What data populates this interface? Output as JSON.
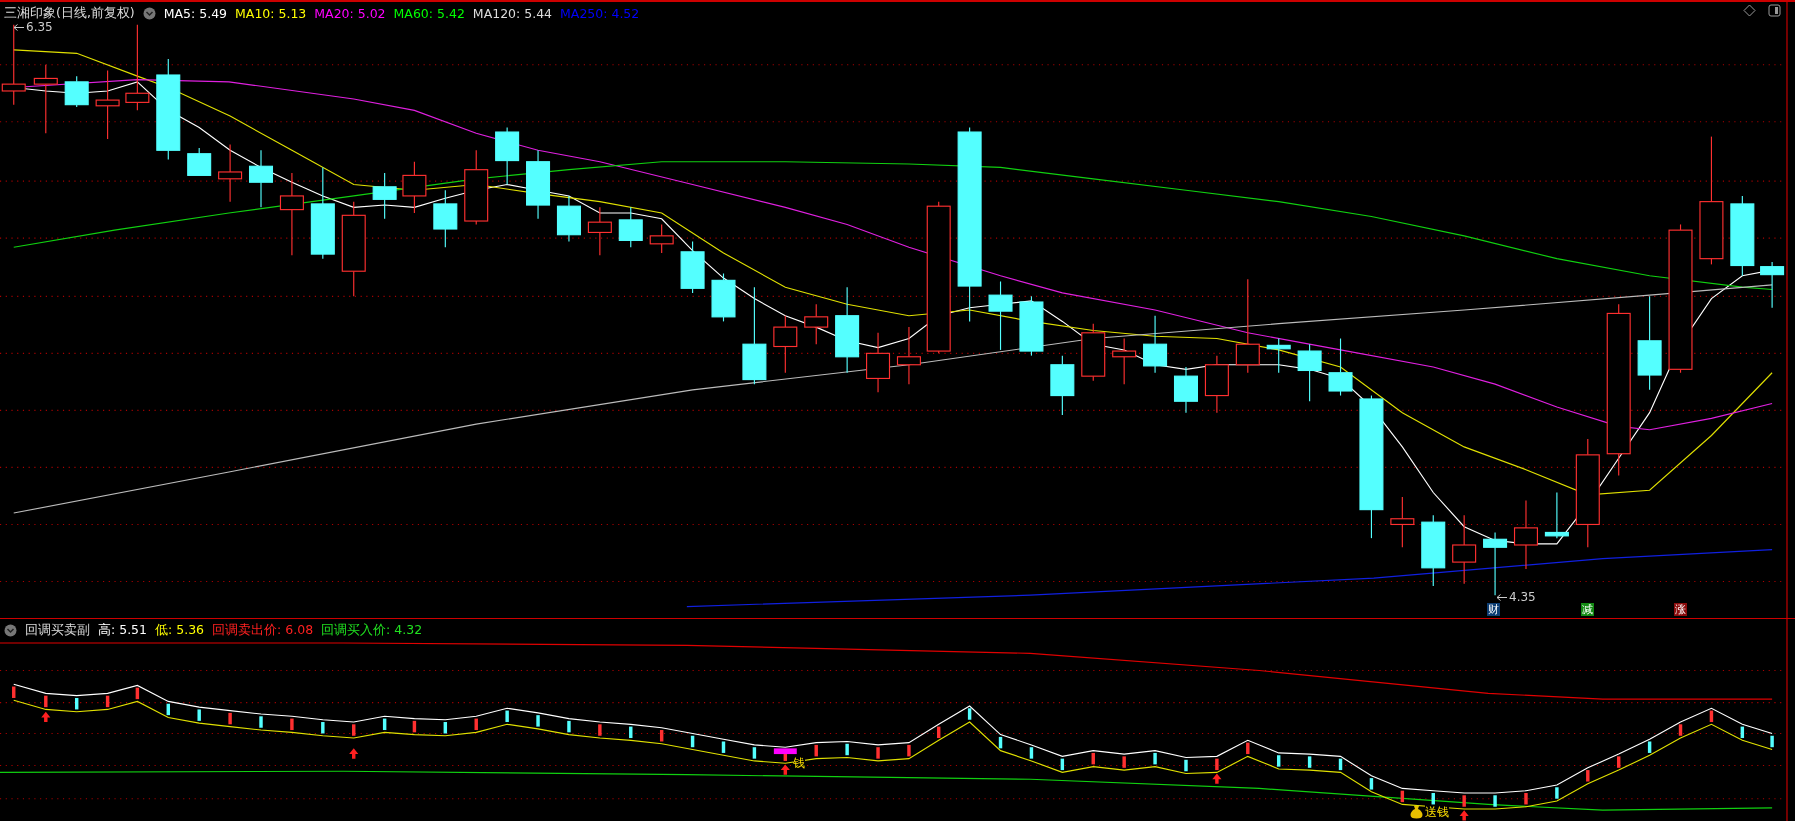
{
  "main_chart": {
    "title": "三湘印象(日线,前复权)",
    "indicators": [
      {
        "label": "MA5: 5.49",
        "color": "#ffffff"
      },
      {
        "label": "MA10: 5.13",
        "color": "#ffff00"
      },
      {
        "label": "MA20: 5.02",
        "color": "#ff00ff"
      },
      {
        "label": "MA60: 5.42",
        "color": "#00ff00"
      },
      {
        "label": "MA120: 5.44",
        "color": "#dddddd"
      },
      {
        "label": "MA250: 4.52",
        "color": "#0000ff"
      }
    ],
    "high_label": "6.35",
    "low_label": "4.35",
    "signal_tags": [
      {
        "text": "财",
        "color": "#0c3d73"
      },
      {
        "text": "减",
        "color": "#138a13"
      },
      {
        "text": "涨",
        "color": "#8a0c0c"
      }
    ]
  },
  "sub_chart": {
    "title": "回调买卖副",
    "indicators": [
      {
        "label": "高: 5.51",
        "color": "#ffffff"
      },
      {
        "label": "低: 5.36",
        "color": "#ffff00"
      },
      {
        "label": "回调卖出价: 6.08",
        "color": "#ff2020"
      },
      {
        "label": "回调买入价: 4.32",
        "color": "#20e020"
      }
    ],
    "buy_mark": "钱",
    "bonus_mark": "送钱"
  }
}
